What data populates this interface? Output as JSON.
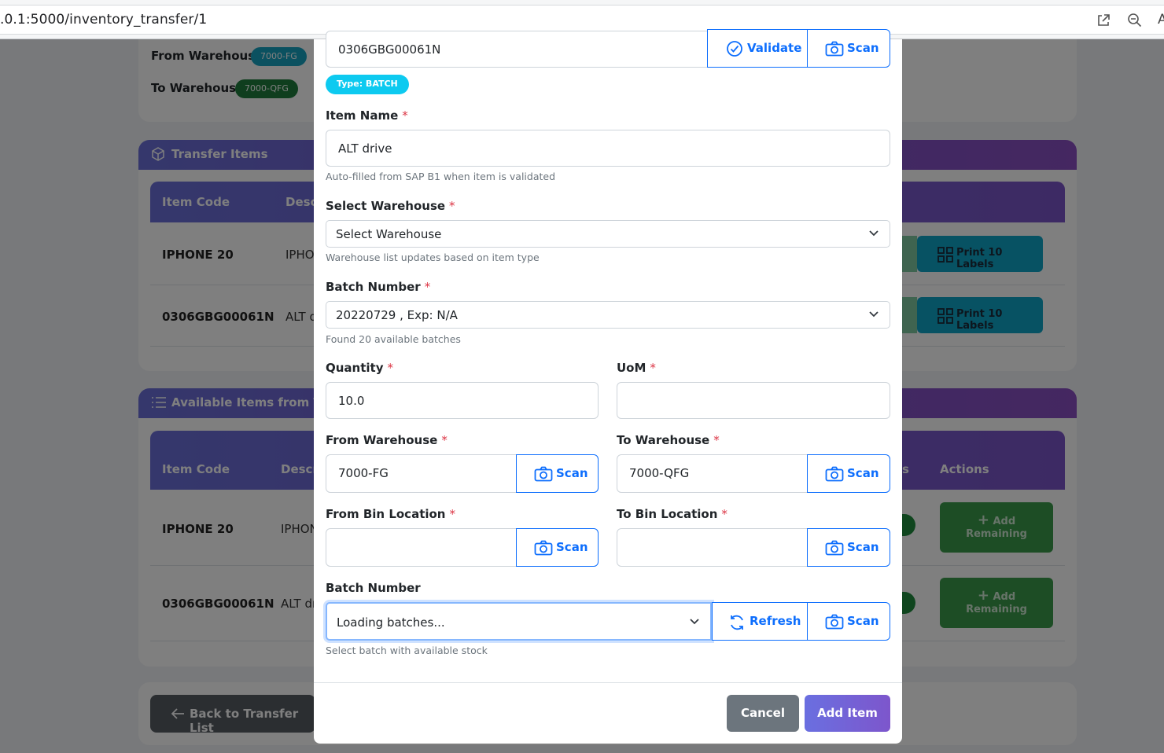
{
  "browser": {
    "url": ".0.1:5000/inventory_transfer/1",
    "icons": [
      "open-external-icon",
      "zoom-out-icon",
      "font-icon"
    ],
    "extra_glyph": "A"
  },
  "background": {
    "from_warehouse_label": "From Warehouse:",
    "from_warehouse_value": "7000-FG",
    "to_warehouse_label": "To Warehouse:",
    "to_warehouse_value": "7000-QFG",
    "transfer_items": {
      "title": "Transfer Items",
      "col_item_code": "Item Code",
      "col_desc": "Descr",
      "rows": [
        {
          "code": "IPHONE 20",
          "desc": "IPHO",
          "print": "Print 10 Labels"
        },
        {
          "code": "0306GBG00061N",
          "desc": "ALT d",
          "print": "Print 10 Labels"
        }
      ]
    },
    "available_items": {
      "title": "Available Items from Trans",
      "col_item_code": "Item Code",
      "col_desc": "Descri",
      "col_actions": "Actions",
      "col_fragment": "s",
      "rows": [
        {
          "code": "IPHONE 20",
          "desc": "IPHON",
          "action_line1": "Add",
          "action_line2": "Remaining"
        },
        {
          "code": "0306GBG00061N",
          "desc": "ALT dr",
          "action_line1": "Add",
          "action_line2": "Remaining"
        }
      ]
    },
    "back_button": "Back to Transfer List"
  },
  "modal": {
    "item_code_value": "0306GBG00061N",
    "validate_label": "Validate",
    "scan_label": "Scan",
    "type_badge": "Type: BATCH",
    "item_name_label": "Item Name",
    "item_name_value": "ALT drive",
    "item_name_help": "Auto-filled from SAP B1 when item is validated",
    "select_warehouse_label": "Select Warehouse",
    "select_warehouse_value": "Select Warehouse",
    "select_warehouse_help": "Warehouse list updates based on item type",
    "batch_number_label": "Batch Number",
    "batch_number_value": "20220729 , Exp: N/A",
    "batch_number_help": "Found 20 available batches",
    "quantity_label": "Quantity",
    "quantity_value": "10.0",
    "uom_label": "UoM",
    "uom_value": "",
    "from_warehouse_label": "From Warehouse",
    "from_warehouse_value": "7000-FG",
    "to_warehouse_label": "To Warehouse",
    "to_warehouse_value": "7000-QFG",
    "from_bin_label": "From Bin Location",
    "from_bin_value": "",
    "to_bin_label": "To Bin Location",
    "to_bin_value": "",
    "batch2_label": "Batch Number",
    "batch2_value": "Loading batches...",
    "refresh_label": "Refresh",
    "batch2_help": "Select batch with available stock",
    "required_mark": "*",
    "cancel_label": "Cancel",
    "add_item_label": "Add Item"
  },
  "colors": {
    "primary": "#0d6efd",
    "info": "#0dcaf0",
    "danger": "#dc3545",
    "secondary": "#6c757d",
    "gradient_start": "#6a6fe0",
    "gradient_end": "#7d56cc"
  }
}
